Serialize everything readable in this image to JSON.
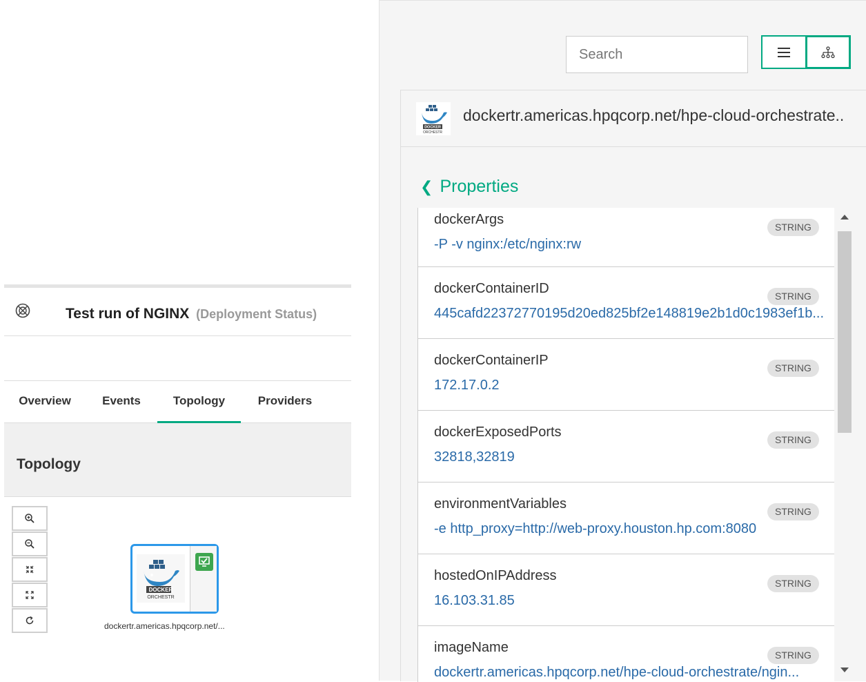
{
  "deployment": {
    "title": "Test run of NGINX",
    "subtitle": "(Deployment Status)"
  },
  "tabs": [
    {
      "label": "Overview",
      "active": false
    },
    {
      "label": "Events",
      "active": false
    },
    {
      "label": "Topology",
      "active": true
    },
    {
      "label": "Providers",
      "active": false
    }
  ],
  "topology": {
    "heading": "Topology",
    "zoom_tools": [
      "zoom-in-icon",
      "zoom-out-icon",
      "collapse-icon",
      "expand-icon",
      "refresh-icon"
    ],
    "node_label": "dockertr.americas.hpqcorp.net/...",
    "node_status_color": "#3ea64f"
  },
  "right_panel": {
    "search_placeholder": "Search",
    "view_buttons": [
      "list-view-icon",
      "tree-view-icon"
    ],
    "resource_name": "dockertr.americas.hpqcorp.net/hpe-cloud-orchestrate..",
    "back_label": "Properties",
    "properties": [
      {
        "name": "dockerArgs",
        "type": "STRING",
        "value": "-P -v nginx:/etc/nginx:rw"
      },
      {
        "name": "dockerContainerID",
        "type": "STRING",
        "value": "445cafd22372770195d20ed825bf2e148819e2b1d0c1983ef1b..."
      },
      {
        "name": "dockerContainerIP",
        "type": "STRING",
        "value": "172.17.0.2"
      },
      {
        "name": "dockerExposedPorts",
        "type": "STRING",
        "value": "32818,32819"
      },
      {
        "name": "environmentVariables",
        "type": "STRING",
        "value": "-e http_proxy=http://web-proxy.houston.hp.com:8080"
      },
      {
        "name": "hostedOnIPAddress",
        "type": "STRING",
        "value": "16.103.31.85"
      },
      {
        "name": "imageName",
        "type": "STRING",
        "value": "dockertr.americas.hpqcorp.net/hpe-cloud-orchestrate/ngin..."
      }
    ]
  },
  "colors": {
    "accent": "#01a982",
    "selection_border": "#2c98e9",
    "value_text": "#2a6aa8"
  }
}
